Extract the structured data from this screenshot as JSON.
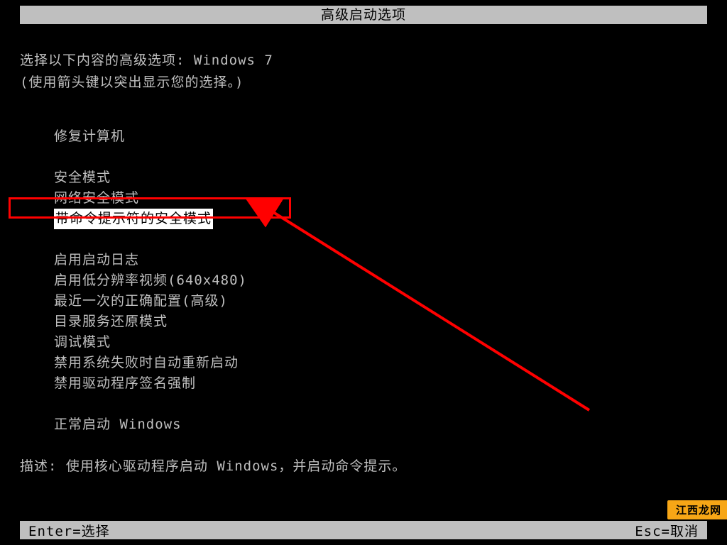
{
  "title": "高级启动选项",
  "prompt": {
    "line1_prefix": "选择以下内容的高级选项: ",
    "line1_os": "Windows 7",
    "line2": "(使用箭头键以突出显示您的选择。)"
  },
  "menu": {
    "repair": "修复计算机",
    "safe_mode": "安全模式",
    "safe_mode_network": "网络安全模式",
    "safe_mode_cmd": "带命令提示符的安全模式",
    "boot_log": "启用启动日志",
    "low_res": "启用低分辨率视频(640x480)",
    "last_known_good": "最近一次的正确配置(高级)",
    "ds_restore": "目录服务还原模式",
    "debug": "调试模式",
    "disable_auto_restart": "禁用系统失败时自动重新启动",
    "disable_driver_sig": "禁用驱动程序签名强制",
    "normal": "正常启动 Windows"
  },
  "description": {
    "label": "描述: ",
    "text": "使用核心驱动程序启动 Windows，并启动命令提示。"
  },
  "footer": {
    "enter": "Enter=选择",
    "esc": "Esc=取消"
  },
  "watermark": "江西龙网"
}
